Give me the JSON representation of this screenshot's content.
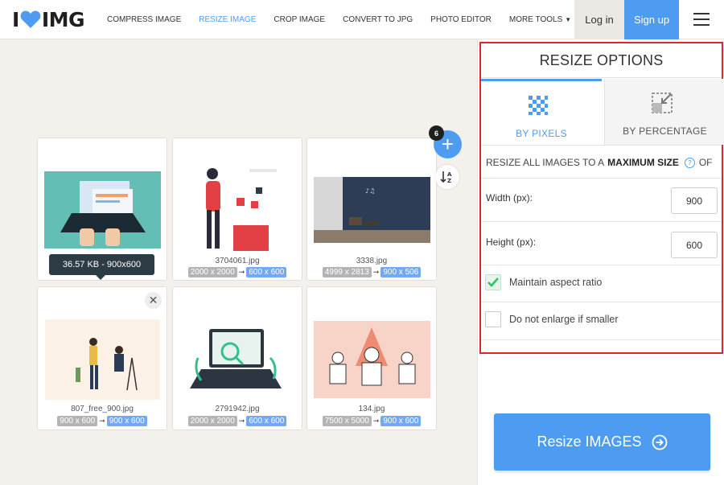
{
  "header": {
    "logo_left": "I",
    "logo_right": "IMG",
    "nav": [
      "COMPRESS IMAGE",
      "RESIZE IMAGE",
      "CROP IMAGE",
      "CONVERT TO JPG",
      "PHOTO EDITOR",
      "MORE TOOLS"
    ],
    "login": "Log in",
    "signup": "Sign up"
  },
  "files": {
    "count": "6",
    "items": [
      {
        "name": "",
        "old": "",
        "new": ""
      },
      {
        "name": "3704061.jpg",
        "old": "2000 x 2000",
        "new": "600 x 600"
      },
      {
        "name": "3338.jpg",
        "old": "4999 x 2813",
        "new": "900 x 506"
      },
      {
        "name": "807_free_900.jpg",
        "old": "900 x 600",
        "new": "900 x 600"
      },
      {
        "name": "2791942.jpg",
        "old": "2000 x 2000",
        "new": "600 x 600"
      },
      {
        "name": "134.jpg",
        "old": "7500 x 5000",
        "new": "900 x 600"
      }
    ],
    "tooltip": "36.57 KB - 900x600"
  },
  "options": {
    "title": "RESIZE OPTIONS",
    "tab_pixels": "BY PIXELS",
    "tab_percentage": "BY PERCENTAGE",
    "resize_all_text": "RESIZE ALL IMAGES TO A",
    "resize_all_bold": "MAXIMUM SIZE",
    "resize_all_suffix": "OF",
    "width_label": "Width (px):",
    "width_value": "900",
    "height_label": "Height (px):",
    "height_value": "600",
    "maintain_aspect": "Maintain aspect ratio",
    "maintain_aspect_checked": true,
    "no_enlarge": "Do not enlarge if smaller",
    "no_enlarge_checked": false
  },
  "actions": {
    "resize_button": "Resize IMAGES"
  },
  "colors": {
    "accent": "#4d9cf2",
    "highlight_border": "#e0252b",
    "check": "#2dbf6a"
  }
}
